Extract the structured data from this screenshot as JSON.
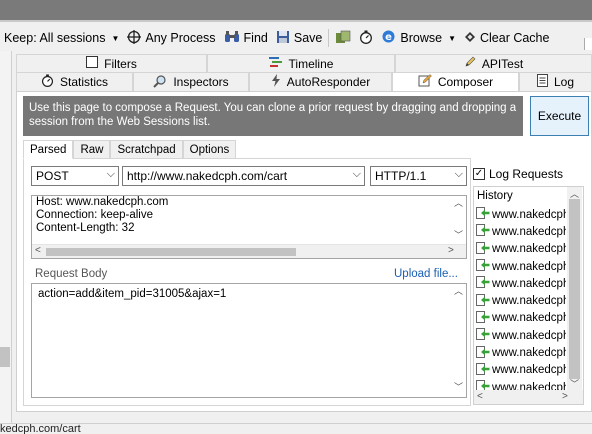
{
  "toolbar": {
    "keep_label": "Keep: All sessions",
    "any_process_label": "Any Process",
    "find_label": "Find",
    "save_label": "Save",
    "browse_label": "Browse",
    "clear_cache_label": "Clear Cache"
  },
  "tabs_row1": [
    "Filters",
    "Timeline",
    "APITest"
  ],
  "tabs_row2": [
    "Statistics",
    "Inspectors",
    "AutoResponder",
    "Composer",
    "Log"
  ],
  "composer": {
    "info_text": "Use this page to compose a Request. You can clone a prior request by dragging and dropping a session from the Web Sessions list.",
    "execute_label": "Execute",
    "subtabs": [
      "Parsed",
      "Raw",
      "Scratchpad",
      "Options"
    ],
    "method": "POST",
    "url": "http://www.nakedcph.com/cart",
    "version": "HTTP/1.1",
    "headers": [
      "Host: www.nakedcph.com",
      "Connection: keep-alive",
      "Content-Length: 32"
    ],
    "request_body_label": "Request Body",
    "upload_label": "Upload file...",
    "body": "action=add&item_pid=31005&ajax=1",
    "log_requests_label": "Log Requests",
    "history_title": "History",
    "history_items": [
      "www.nakedcph",
      "www.nakedcph",
      "www.nakedcph",
      "www.nakedcph",
      "www.nakedcph",
      "www.nakedcph",
      "www.nakedcph",
      "www.nakedcph",
      "www.nakedcph",
      "www.nakedcph",
      "www.nakedcph",
      "www.nakedcph"
    ]
  },
  "statusbar": {
    "text": "kedcph.com/cart"
  },
  "colors": {
    "info_bg": "#777777",
    "execute_border": "#3c7fb1",
    "link": "#1a5fb4"
  }
}
